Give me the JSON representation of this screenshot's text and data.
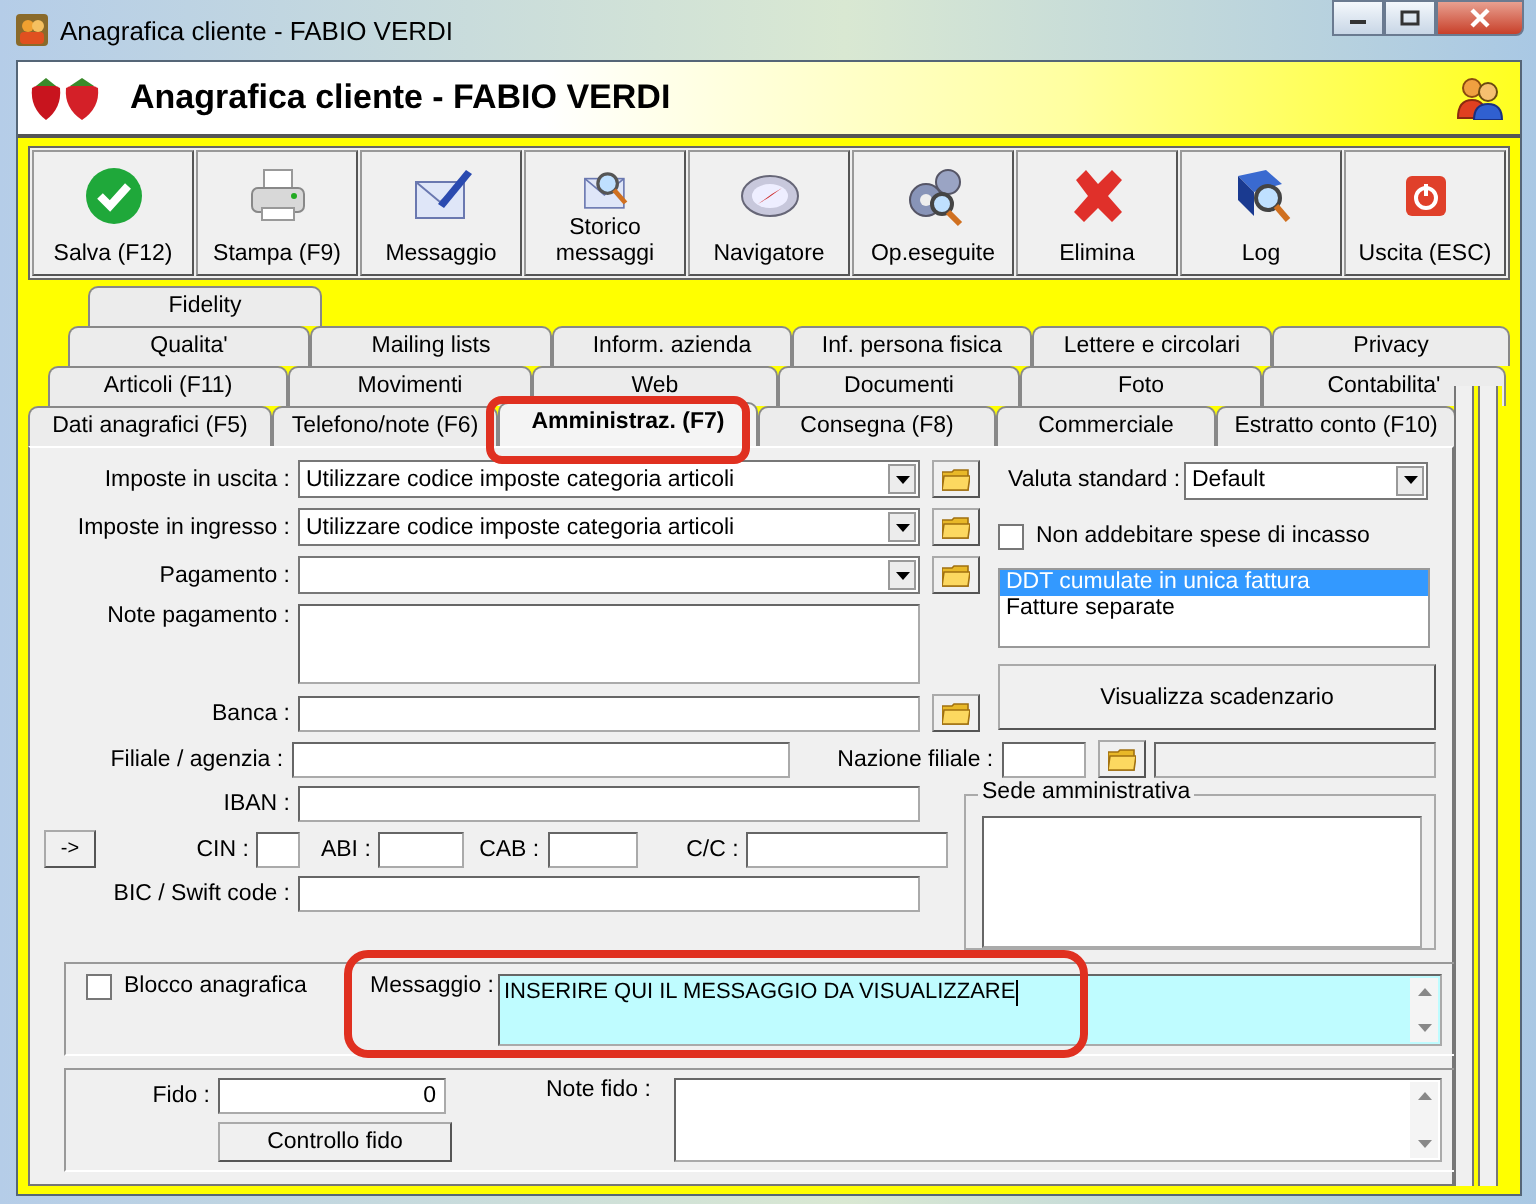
{
  "window": {
    "title": "Anagrafica cliente - FABIO VERDI"
  },
  "header": {
    "title": "Anagrafica cliente - FABIO VERDI"
  },
  "toolbar": [
    {
      "label": "Salva (F12)",
      "kind": "check"
    },
    {
      "label": "Stampa (F9)",
      "kind": "printer"
    },
    {
      "label": "Messaggio",
      "kind": "mail"
    },
    {
      "label": "Storico messaggi",
      "kind": "mailsearch"
    },
    {
      "label": "Navigatore",
      "kind": "compass"
    },
    {
      "label": "Op.eseguite",
      "kind": "gears"
    },
    {
      "label": "Elimina",
      "kind": "cross"
    },
    {
      "label": "Log",
      "kind": "book"
    },
    {
      "label": "Uscita (ESC)",
      "kind": "power"
    }
  ],
  "tab_rows": [
    [
      {
        "label": "Fidelity",
        "selected": false
      }
    ],
    [
      {
        "label": "Qualita'",
        "selected": false
      },
      {
        "label": "Mailing lists",
        "selected": false
      },
      {
        "label": "Inform. azienda",
        "selected": false
      },
      {
        "label": "Inf. persona fisica",
        "selected": false
      },
      {
        "label": "Lettere e circolari",
        "selected": false
      },
      {
        "label": "Privacy",
        "selected": false
      }
    ],
    [
      {
        "label": "Articoli (F11)",
        "selected": false
      },
      {
        "label": "Movimenti",
        "selected": false
      },
      {
        "label": "Web",
        "selected": false
      },
      {
        "label": "Documenti",
        "selected": false
      },
      {
        "label": "Foto",
        "selected": false
      },
      {
        "label": "Contabilita'",
        "selected": false
      }
    ],
    [
      {
        "label": "Dati anagrafici (F5)",
        "selected": false
      },
      {
        "label": "Telefono/note (F6)",
        "selected": false
      },
      {
        "label": "Amministraz. (F7)",
        "selected": true,
        "highlighted": true
      },
      {
        "label": "Consegna (F8)",
        "selected": false
      },
      {
        "label": "Commerciale",
        "selected": false
      },
      {
        "label": "Estratto conto (F10)",
        "selected": false
      }
    ]
  ],
  "form": {
    "imposte_uscita": {
      "label": "Imposte in uscita :",
      "value": "Utilizzare codice imposte categoria articoli"
    },
    "imposte_ingresso": {
      "label": "Imposte in ingresso :",
      "value": "Utilizzare codice imposte categoria articoli"
    },
    "pagamento": {
      "label": "Pagamento :"
    },
    "note_pagamento": {
      "label": "Note pagamento :"
    },
    "banca": {
      "label": "Banca :"
    },
    "filiale": {
      "label": "Filiale / agenzia :"
    },
    "nazione_filiale": {
      "label": "Nazione filiale :"
    },
    "iban": {
      "label": "IBAN :"
    },
    "arrow_button": "->",
    "cin": {
      "label": "CIN :"
    },
    "abi": {
      "label": "ABI :"
    },
    "cab": {
      "label": "CAB :"
    },
    "cc": {
      "label": "C/C :"
    },
    "bic": {
      "label": "BIC / Swift code :"
    },
    "valuta": {
      "label": "Valuta standard :",
      "value": "Default"
    },
    "spese": {
      "label": "Non addebitare spese di incasso",
      "checked": false
    },
    "fatturazione": [
      {
        "label": "DDT cumulate in unica fattura",
        "selected": true
      },
      {
        "label": "Fatture separate",
        "selected": false
      }
    ],
    "scadenzario_button": "Visualizza scadenzario",
    "sede": {
      "label": "Sede amministrativa"
    },
    "blocco": {
      "label": "Blocco anagrafica",
      "checked": false
    },
    "messaggio": {
      "label": "Messaggio :",
      "value": "INSERIRE QUI IL MESSAGGIO DA VISUALIZZARE",
      "highlighted": true
    },
    "fido": {
      "label": "Fido :",
      "value": "0"
    },
    "controllo_button": "Controllo fido",
    "note_fido": {
      "label": "Note fido :"
    }
  }
}
